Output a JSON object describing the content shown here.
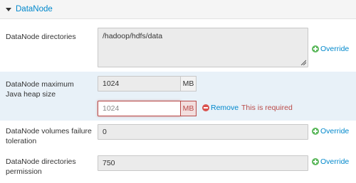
{
  "section": {
    "title": "DataNode"
  },
  "rows": {
    "directories": {
      "label": "DataNode directories",
      "value": "/hadoop/hdfs/data",
      "override": "Override"
    },
    "heap": {
      "label": "DataNode maximum Java heap size",
      "value": "1024",
      "unit": "MB",
      "override_value": "1024",
      "override_unit": "MB",
      "remove": "Remove",
      "error": "This is required"
    },
    "failure": {
      "label": "DataNode volumes failure toleration",
      "value": "0",
      "override": "Override"
    },
    "permission": {
      "label": "DataNode directories permission",
      "value": "750",
      "override": "Override"
    }
  },
  "colors": {
    "link": "#0088cc",
    "error": "#b94a48",
    "highlight": "#e8f1f8",
    "override_icon": "#5cb85c",
    "remove_icon": "#d9534f"
  }
}
